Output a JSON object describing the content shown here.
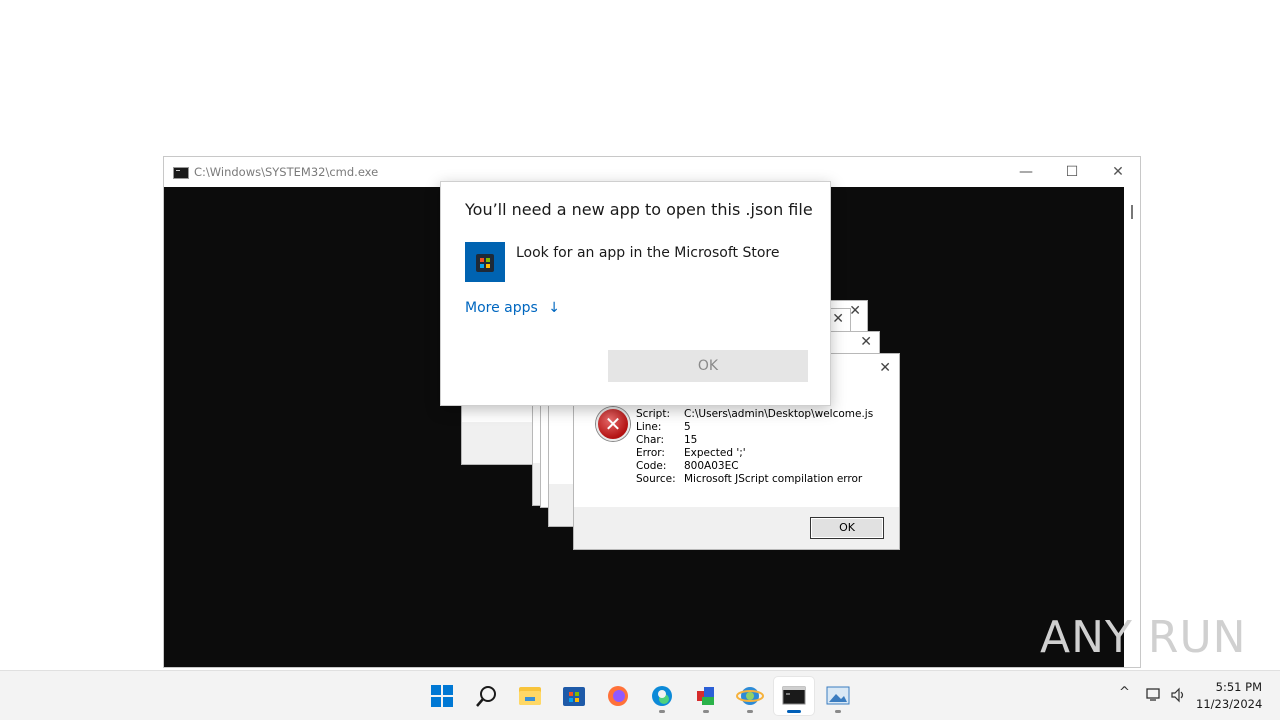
{
  "cmd_window": {
    "title": "C:\\Windows\\SYSTEM32\\cmd.exe",
    "minimize": "—",
    "maximize": "☐",
    "close": "✕"
  },
  "open_with_dialog": {
    "title": "You’ll need a new app to open this .json file",
    "store_option": "Look for an app in the Microsoft Store",
    "more_apps": "More apps",
    "more_apps_arrow": "↓",
    "ok_label": "OK"
  },
  "script_error_dialog": {
    "close": "✕",
    "rows": [
      {
        "key": "Script:",
        "value": "C:\\Users\\admin\\Desktop\\welcome.js"
      },
      {
        "key": "Line:",
        "value": "5"
      },
      {
        "key": "Char:",
        "value": "15"
      },
      {
        "key": "Error:",
        "value": "Expected ';'"
      },
      {
        "key": "Code:",
        "value": "800A03EC"
      },
      {
        "key": "Source:",
        "value": "Microsoft JScript compilation error"
      }
    ],
    "ok_label": "OK"
  },
  "background_dialogs_close": "✕",
  "taskbar": {
    "apps": [
      "start-icon",
      "search-icon",
      "file-explorer-icon",
      "microsoft-store-icon",
      "firefox-icon",
      "edge-icon",
      "app-icon",
      "ie-icon",
      "cmd-icon",
      "image-app-icon"
    ],
    "tray": {
      "chevron": "^",
      "time": "5:51 PM",
      "date": "11/23/2024"
    }
  },
  "watermark": "ANY RUN",
  "colors": {
    "accent": "#0067c0",
    "store_blue": "#0063b1",
    "console_bg": "#0c0c0c",
    "error_red": "#b31212"
  }
}
